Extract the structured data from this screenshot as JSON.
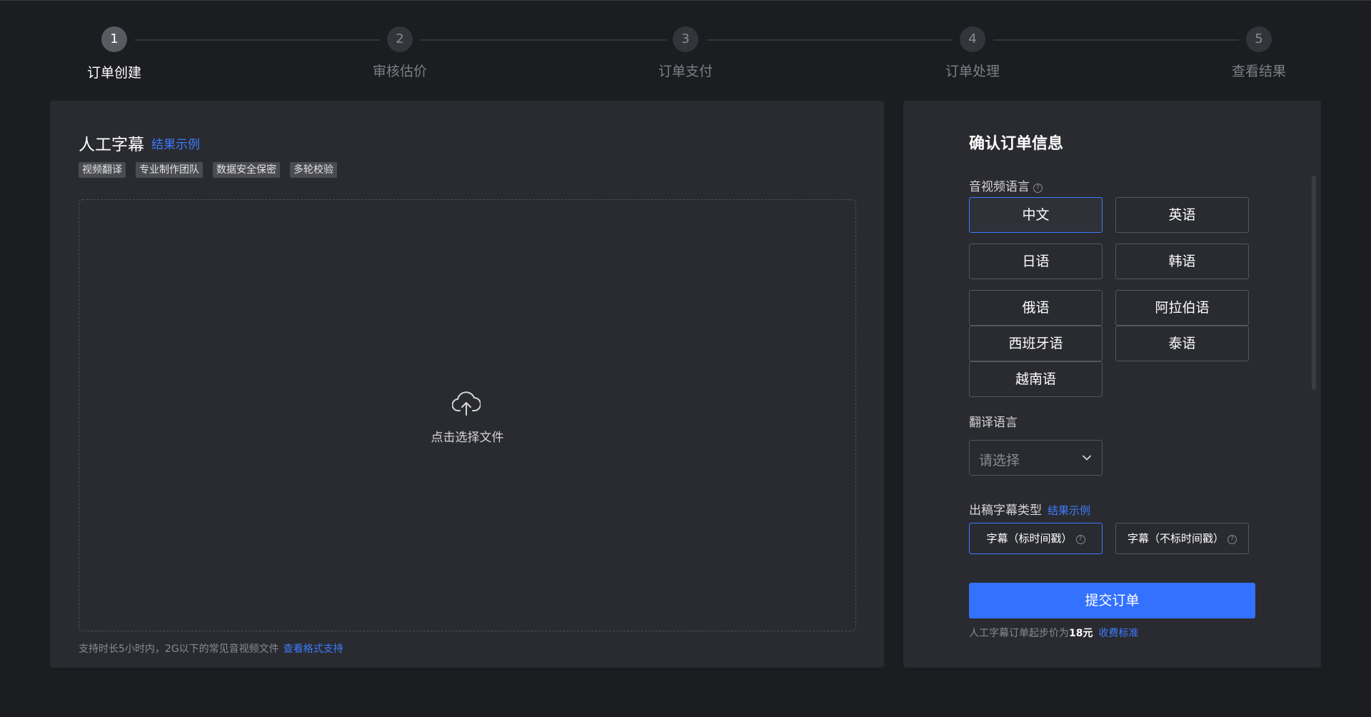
{
  "steps": [
    {
      "num": "1",
      "label": "订单创建",
      "active": true
    },
    {
      "num": "2",
      "label": "审核估价",
      "active": false
    },
    {
      "num": "3",
      "label": "订单支付",
      "active": false
    },
    {
      "num": "4",
      "label": "订单处理",
      "active": false
    },
    {
      "num": "5",
      "label": "查看结果",
      "active": false
    }
  ],
  "left_panel": {
    "title": "人工字幕",
    "title_link": "结果示例",
    "tags": [
      "视频翻译",
      "专业制作团队",
      "数据安全保密",
      "多轮校验"
    ],
    "upload_text": "点击选择文件",
    "upload_icon": "cloud-upload-icon",
    "footer_text": "支持时长5小时内，2G以下的常见音视频文件",
    "footer_link": "查看格式支持"
  },
  "right_panel": {
    "title": "确认订单信息",
    "audio_language_label": "音视频语言",
    "help_icon": "?",
    "languages": [
      "中文",
      "英语",
      "日语",
      "韩语",
      "俄语",
      "阿拉伯语",
      "西班牙语",
      "泰语",
      "越南语"
    ],
    "selected_language": "中文",
    "translation_label": "翻译语言",
    "translation_placeholder": "请选择",
    "subtitle_type_label": "出稿字幕类型",
    "subtitle_type_link": "结果示例",
    "subtitle_types": [
      "字幕（标时间戳）",
      "字幕（不标时间戳）"
    ],
    "selected_subtitle_type": "字幕（标时间戳）",
    "submit_label": "提交订单",
    "price_prefix": "人工字幕订单起步价为",
    "price_value": "18元",
    "price_link": "收费标准"
  },
  "colors": {
    "background": "#1c1d21",
    "panel": "#2a2b30",
    "accent": "#3371ff",
    "link": "#3d7bff"
  }
}
